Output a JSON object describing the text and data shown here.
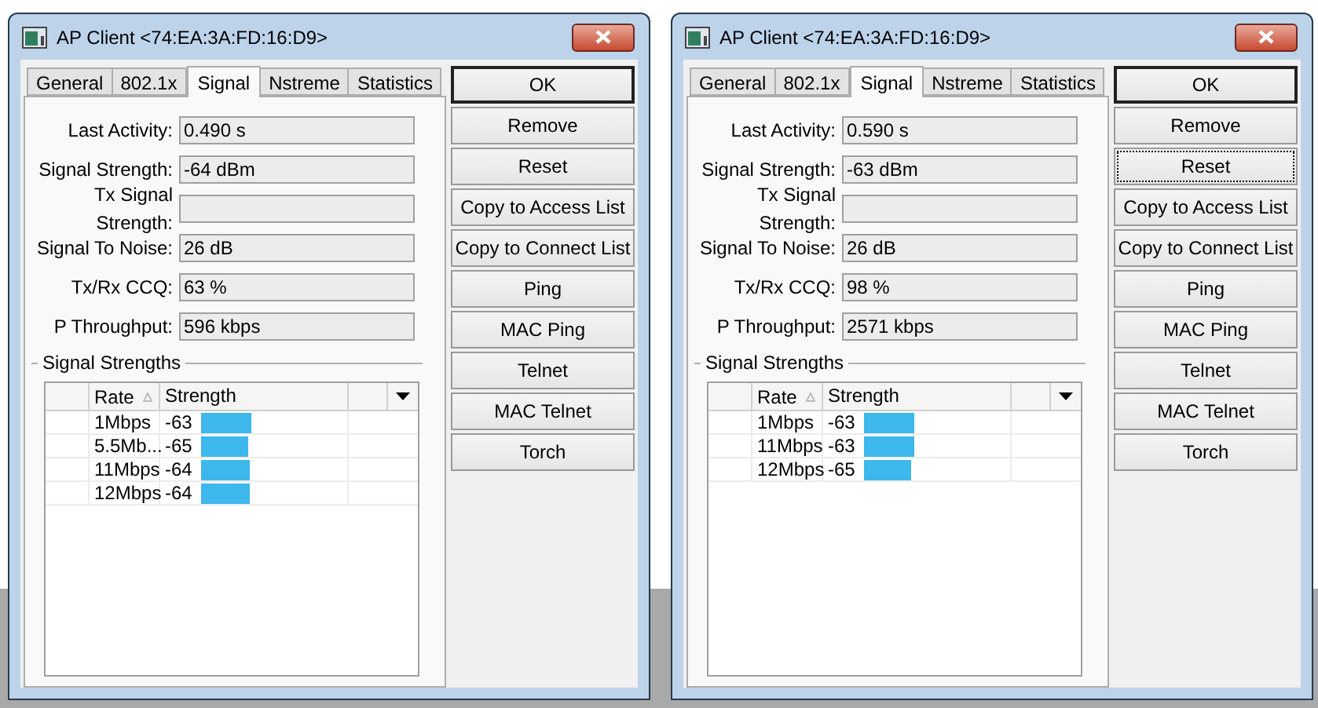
{
  "windows": [
    {
      "title": "AP Client <74:EA:3A:FD:16:D9>",
      "tabs": [
        {
          "label": "General",
          "selected": false
        },
        {
          "label": "802.1x",
          "selected": false
        },
        {
          "label": "Signal",
          "selected": true
        },
        {
          "label": "Nstreme",
          "selected": false
        },
        {
          "label": "Statistics",
          "selected": false
        }
      ],
      "fields": [
        {
          "label": "Last Activity:",
          "value": "0.490 s"
        },
        {
          "label": "Signal Strength:",
          "value": "-64 dBm"
        },
        {
          "label": "Tx Signal Strength:"
        },
        {
          "label": "Signal To Noise:",
          "value": "26 dB"
        },
        {
          "label": "Tx/Rx CCQ:",
          "value": "63 %"
        },
        {
          "label": "P Throughput:",
          "value": "596 kbps"
        }
      ],
      "group_title": "Signal Strengths",
      "table": {
        "columns": [
          "Rate",
          "Strength"
        ],
        "rows": [
          {
            "rate": "1Mbps",
            "strength": "-63",
            "level": 0.34
          },
          {
            "rate": "5.5Mb...",
            "strength": "-65",
            "level": 0.32
          },
          {
            "rate": "11Mbps",
            "strength": "-64",
            "level": 0.33
          },
          {
            "rate": "12Mbps",
            "strength": "-64",
            "level": 0.33
          }
        ]
      },
      "buttons": [
        {
          "label": "OK",
          "default": true,
          "focused": false
        },
        {
          "label": "Remove",
          "default": false,
          "focused": false
        },
        {
          "label": "Reset",
          "default": false,
          "focused": false
        },
        {
          "label": "Copy to Access List",
          "default": false,
          "focused": false
        },
        {
          "label": "Copy to Connect List",
          "default": false,
          "focused": false
        },
        {
          "label": "Ping",
          "default": false,
          "focused": false
        },
        {
          "label": "MAC Ping",
          "default": false,
          "focused": false
        },
        {
          "label": "Telnet",
          "default": false,
          "focused": false
        },
        {
          "label": "MAC Telnet",
          "default": false,
          "focused": false
        },
        {
          "label": "Torch",
          "default": false,
          "focused": false
        }
      ]
    },
    {
      "title": "AP Client <74:EA:3A:FD:16:D9>",
      "tabs": [
        {
          "label": "General",
          "selected": false
        },
        {
          "label": "802.1x",
          "selected": false
        },
        {
          "label": "Signal",
          "selected": true
        },
        {
          "label": "Nstreme",
          "selected": false
        },
        {
          "label": "Statistics",
          "selected": false
        }
      ],
      "fields": [
        {
          "label": "Last Activity:",
          "value": "0.590 s"
        },
        {
          "label": "Signal Strength:",
          "value": "-63 dBm"
        },
        {
          "label": "Tx Signal Strength:"
        },
        {
          "label": "Signal To Noise:",
          "value": "26 dB"
        },
        {
          "label": "Tx/Rx CCQ:",
          "value": "98 %"
        },
        {
          "label": "P Throughput:",
          "value": "2571 kbps"
        }
      ],
      "group_title": "Signal Strengths",
      "table": {
        "columns": [
          "Rate",
          "Strength"
        ],
        "rows": [
          {
            "rate": "1Mbps",
            "strength": "-63",
            "level": 0.34
          },
          {
            "rate": "11Mbps",
            "strength": "-63",
            "level": 0.34
          },
          {
            "rate": "12Mbps",
            "strength": "-65",
            "level": 0.32
          }
        ]
      },
      "buttons": [
        {
          "label": "OK",
          "default": true,
          "focused": false
        },
        {
          "label": "Remove",
          "default": false,
          "focused": false
        },
        {
          "label": "Reset",
          "default": false,
          "focused": true
        },
        {
          "label": "Copy to Access List",
          "default": false,
          "focused": false
        },
        {
          "label": "Copy to Connect List",
          "default": false,
          "focused": false
        },
        {
          "label": "Ping",
          "default": false,
          "focused": false
        },
        {
          "label": "MAC Ping",
          "default": false,
          "focused": false
        },
        {
          "label": "Telnet",
          "default": false,
          "focused": false
        },
        {
          "label": "MAC Telnet",
          "default": false,
          "focused": false
        },
        {
          "label": "Torch",
          "default": false,
          "focused": false
        }
      ]
    }
  ]
}
